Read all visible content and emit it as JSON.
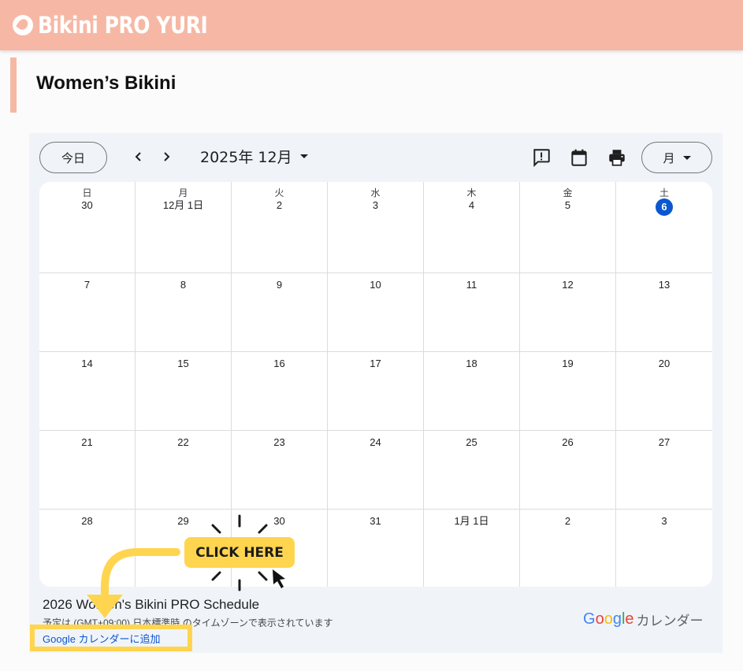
{
  "header": {
    "brand": "Bikini PRO YURI",
    "brand_color": "#f6b8a5"
  },
  "section": {
    "title": "Women’s Bikini"
  },
  "calendar": {
    "today_label": "今日",
    "month_title": "2025年 12月",
    "view_label": "月",
    "weekdays": [
      "日",
      "月",
      "火",
      "水",
      "木",
      "金",
      "土"
    ],
    "weeks": [
      [
        "30",
        "12月 1日",
        "2",
        "3",
        "4",
        "5",
        "6"
      ],
      [
        "7",
        "8",
        "9",
        "10",
        "11",
        "12",
        "13"
      ],
      [
        "14",
        "15",
        "16",
        "17",
        "18",
        "19",
        "20"
      ],
      [
        "21",
        "22",
        "23",
        "24",
        "25",
        "26",
        "27"
      ],
      [
        "28",
        "29",
        "30",
        "31",
        "1月 1日",
        "2",
        "3"
      ]
    ],
    "today_date": "6",
    "accent": "#0b57d0"
  },
  "footer": {
    "title": "2026 Women's Bikini PRO Schedule",
    "timezone_note": "予定は (GMT+09:00) 日本標準時 のタイムゾーンで表示されています",
    "add_link": "Google カレンダーに追加",
    "google_word": [
      "G",
      "o",
      "o",
      "g",
      "l",
      "e"
    ],
    "google_colors": [
      "#4285f4",
      "#ea4335",
      "#fbbc05",
      "#4285f4",
      "#34a853",
      "#ea4335"
    ],
    "calendar_word": "カレンダー"
  },
  "overlay": {
    "click_here": "CLICK HERE",
    "highlight_color": "#ffd54f"
  }
}
